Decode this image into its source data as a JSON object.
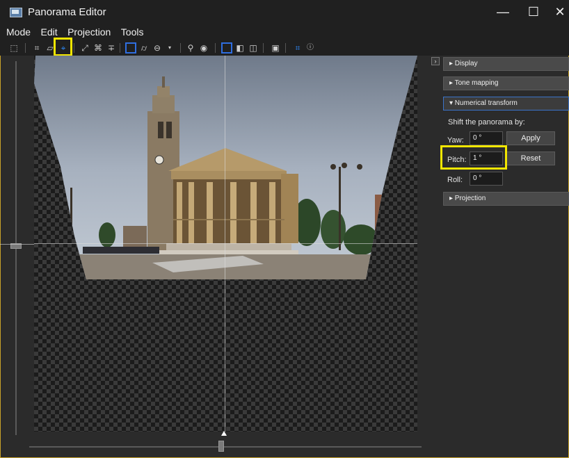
{
  "window": {
    "title": "Panorama Editor",
    "minimize_icon": "—",
    "maximize_icon": "☐",
    "close_icon": "✕"
  },
  "menu": {
    "items": [
      "Mode",
      "Edit",
      "Projection",
      "Tools"
    ]
  },
  "toolbar": {
    "icons": [
      "select-icon",
      "layout-icon",
      "crop-icon",
      "move-drag-icon",
      "fit-icon",
      "center-icon",
      "straighten-icon",
      "rectilinear-icon",
      "cylindrical-icon",
      "equirectangular-icon",
      "dropdown-icon",
      "zoom-icon",
      "preview-icon",
      "view-full-icon",
      "view-half-icon",
      "view-split-icon",
      "overview-icon",
      "identify-icon",
      "help-icon"
    ]
  },
  "side_panel": {
    "sections": [
      {
        "label": "▸ Display",
        "open": false
      },
      {
        "label": "▸ Tone mapping",
        "open": false
      },
      {
        "label": "▾ Numerical transform",
        "open": true
      },
      {
        "label": "▸ Projection",
        "open": false
      }
    ],
    "numerical_transform": {
      "heading": "Shift the panorama by:",
      "yaw_label": "Yaw:",
      "yaw_value": "0 °",
      "pitch_label": "Pitch:",
      "pitch_value": "1 °",
      "roll_label": "Roll:",
      "roll_value": "0 °",
      "apply_label": "Apply",
      "reset_label": "Reset"
    },
    "collapse_glyph": "›"
  },
  "colors": {
    "highlight": "#f2e600",
    "accent": "#2f8cff",
    "background": "#2b2b2b"
  }
}
